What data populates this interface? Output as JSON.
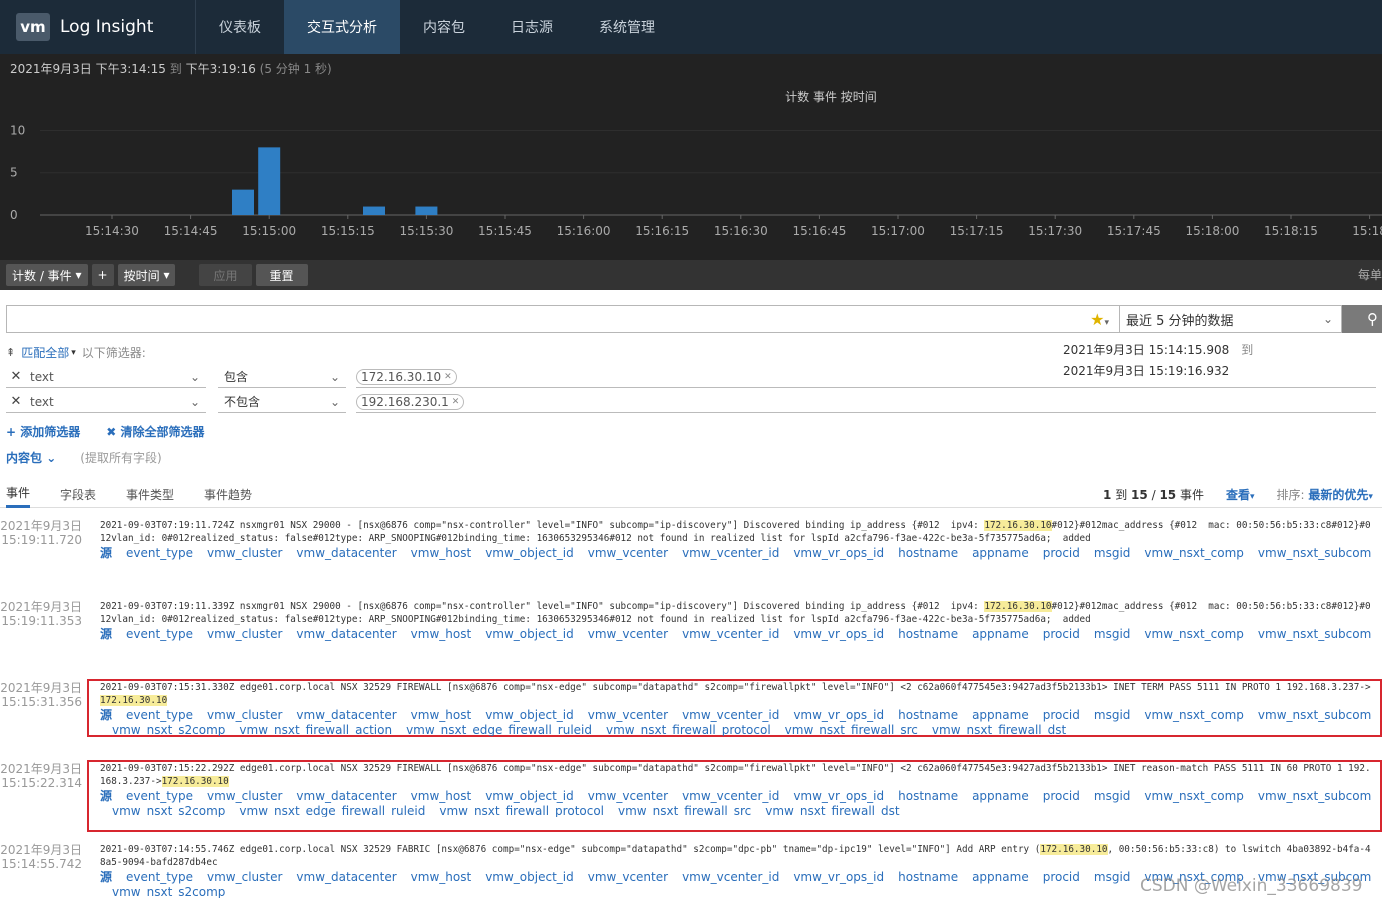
{
  "app": {
    "logo_mark": "vm",
    "title": "Log Insight"
  },
  "nav": [
    {
      "label": "仪表板",
      "active": false
    },
    {
      "label": "交互式分析",
      "active": true
    },
    {
      "label": "内容包",
      "active": false
    },
    {
      "label": "日志源",
      "active": false
    },
    {
      "label": "系统管理",
      "active": false
    }
  ],
  "range": {
    "text": "2021年9月3日  下午3:14:15",
    "to": "到",
    "end": "下午3:19:16",
    "duration": "(5 分钟 1 秒)"
  },
  "chart_data": {
    "type": "bar",
    "title": "计数 事件 按时间",
    "yticks": [
      0,
      5,
      10
    ],
    "ylim": [
      0,
      11
    ],
    "xticks": [
      "15:14:30",
      "15:14:45",
      "15:15:00",
      "15:15:15",
      "15:15:30",
      "15:15:45",
      "15:16:00",
      "15:16:15",
      "15:16:30",
      "15:16:45",
      "15:17:00",
      "15:17:15",
      "15:17:30",
      "15:17:45",
      "15:18:00",
      "15:18:15",
      "15:18"
    ],
    "bars": [
      {
        "t": "15:14:55",
        "value": 3
      },
      {
        "t": "15:15:00",
        "value": 8
      },
      {
        "t": "15:15:20",
        "value": 1
      },
      {
        "t": "15:15:30",
        "value": 1
      }
    ],
    "bar_color": "#2f7fc5"
  },
  "toolbar": {
    "count_label": "计数 / 事件",
    "plus": "+",
    "bytime_label": "按时间",
    "apply": "应用",
    "reset": "重置",
    "right_text": "每单"
  },
  "search": {
    "time_option": "最近 5 分钟的数据"
  },
  "filters_header": {
    "match": "匹配全部",
    "following": "以下筛选器:"
  },
  "time_range": {
    "from": "2021年9月3日  15:14:15.908",
    "to_label": "到",
    "to": "2021年9月3日  15:19:16.932"
  },
  "filters": [
    {
      "field": "text",
      "op": "包含",
      "value": "172.16.30.10"
    },
    {
      "field": "text",
      "op": "不包含",
      "value": "192.168.230.1"
    }
  ],
  "filter_actions": {
    "add": "+ 添加筛选器",
    "clear": "✖ 清除全部筛选器"
  },
  "content_pack": {
    "label": "内容包",
    "hint": "(提取所有字段)"
  },
  "tabs": [
    {
      "label": "事件",
      "active": true
    },
    {
      "label": "字段表",
      "active": false
    },
    {
      "label": "事件类型",
      "active": false
    },
    {
      "label": "事件趋势",
      "active": false
    }
  ],
  "results": {
    "range_a": "1",
    "to": "到",
    "range_b": "15",
    "sep": "/",
    "total": "15",
    "unit": "事件",
    "view": "查看",
    "sort_label": "排序:",
    "sort_value": "最新的优先"
  },
  "events": [
    {
      "date": "2021年9月3日",
      "time": "15:19:11.720",
      "text_a": "2021-09-03T07:19:11.724Z nsxmgr01 NSX 29000 - [nsx@6876 comp=\"nsx-controller\" level=\"INFO\" subcomp=\"ip-discovery\"] Discovered binding ip_address {#012  ipv4: ",
      "hl": "172.16.30.10",
      "text_b": "#012}#012mac_address {#012  mac: 00:50:56:b5:33:c8#012}#012vlan_id: 0#012realized_status: false#012type: ARP_SNOOPING#012binding_time: 1630653295346#012 not found in realized list for lspId a2cfa796-f3ae-422c-be3a-5f735775ad6a;  added",
      "fields": [
        "源",
        "event_type",
        "vmw_cluster",
        "vmw_datacenter",
        "vmw_host",
        "vmw_object_id",
        "vmw_vcenter",
        "vmw_vcenter_id",
        "vmw_vr_ops_id",
        "hostname",
        "appname",
        "procid",
        "msgid",
        "vmw_nsxt_comp",
        "vmw_nsxt_subcomp"
      ]
    },
    {
      "date": "2021年9月3日",
      "time": "15:19:11.353",
      "text_a": "2021-09-03T07:19:11.339Z nsxmgr01 NSX 29000 - [nsx@6876 comp=\"nsx-controller\" level=\"INFO\" subcomp=\"ip-discovery\"] Discovered binding ip_address {#012  ipv4: ",
      "hl": "172.16.30.10",
      "text_b": "#012}#012mac_address {#012  mac: 00:50:56:b5:33:c8#012}#012vlan_id: 0#012realized_status: false#012type: ARP_SNOOPING#012binding_time: 1630653295346#012 not found in realized list for lspId a2cfa796-f3ae-422c-be3a-5f735775ad6a;  added",
      "fields": [
        "源",
        "event_type",
        "vmw_cluster",
        "vmw_datacenter",
        "vmw_host",
        "vmw_object_id",
        "vmw_vcenter",
        "vmw_vcenter_id",
        "vmw_vr_ops_id",
        "hostname",
        "appname",
        "procid",
        "msgid",
        "vmw_nsxt_comp",
        "vmw_nsxt_subcomp"
      ]
    },
    {
      "date": "2021年9月3日",
      "time": "15:15:31.356",
      "text_a": "2021-09-03T07:15:31.330Z edge01.corp.local NSX 32529 FIREWALL [nsx@6876 comp=\"nsx-edge\" subcomp=\"datapathd\" s2comp=\"firewallpkt\" level=\"INFO\"] <2 c62a060f477545e3:9427ad3f5b2133b1> INET TERM PASS 5111 IN PROTO 1 192.168.3.237->",
      "hl": "172.16.30.10",
      "text_b": "",
      "fields": [
        "源",
        "event_type",
        "vmw_cluster",
        "vmw_datacenter",
        "vmw_host",
        "vmw_object_id",
        "vmw_vcenter",
        "vmw_vcenter_id",
        "vmw_vr_ops_id",
        "hostname",
        "appname",
        "procid",
        "msgid",
        "vmw_nsxt_comp",
        "vmw_nsxt_subcomp"
      ],
      "fields2": [
        "vmw_nsxt_s2comp",
        "vmw_nsxt_firewall_action",
        "vmw_nsxt_edge_firewall_ruleid",
        "vmw_nsxt_firewall_protocol",
        "vmw_nsxt_firewall_src",
        "vmw_nsxt_firewall_dst"
      ]
    },
    {
      "date": "2021年9月3日",
      "time": "15:15:22.314",
      "text_a": "2021-09-03T07:15:22.292Z edge01.corp.local NSX 32529 FIREWALL [nsx@6876 comp=\"nsx-edge\" subcomp=\"datapathd\" s2comp=\"firewallpkt\" level=\"INFO\"] <2 c62a060f477545e3:9427ad3f5b2133b1> INET reason-match PASS 5111 IN 60 PROTO 1 192.168.3.237->",
      "hl": "172.16.30.10",
      "text_b": "",
      "fields": [
        "源",
        "event_type",
        "vmw_cluster",
        "vmw_datacenter",
        "vmw_host",
        "vmw_object_id",
        "vmw_vcenter",
        "vmw_vcenter_id",
        "vmw_vr_ops_id",
        "hostname",
        "appname",
        "procid",
        "msgid",
        "vmw_nsxt_comp",
        "vmw_nsxt_subcomp"
      ],
      "fields2": [
        "vmw_nsxt_s2comp",
        "vmw_nsxt_edge_firewall_ruleid",
        "vmw_nsxt_firewall_protocol",
        "vmw_nsxt_firewall_src",
        "vmw_nsxt_firewall_dst"
      ]
    },
    {
      "date": "2021年9月3日",
      "time": "15:14:55.742",
      "text_a": "2021-09-03T07:14:55.746Z edge01.corp.local NSX 32529 FABRIC [nsx@6876 comp=\"nsx-edge\" subcomp=\"datapathd\" s2comp=\"dpc-pb\" tname=\"dp-ipc19\" level=\"INFO\"] Add ARP entry (",
      "hl": "172.16.30.10",
      "text_b": ", 00:50:56:b5:33:c8) to lswitch 4ba03892-b4fa-48a5-9094-bafd287db4ec",
      "fields": [
        "源",
        "event_type",
        "vmw_cluster",
        "vmw_datacenter",
        "vmw_host",
        "vmw_object_id",
        "vmw_vcenter",
        "vmw_vcenter_id",
        "vmw_vr_ops_id",
        "hostname",
        "appname",
        "procid",
        "msgid",
        "vmw_nsxt_comp",
        "vmw_nsxt_subcomp"
      ],
      "fields2": [
        "vmw_nsxt_s2comp"
      ]
    }
  ],
  "watermark": "CSDN @Weixin_33669839"
}
